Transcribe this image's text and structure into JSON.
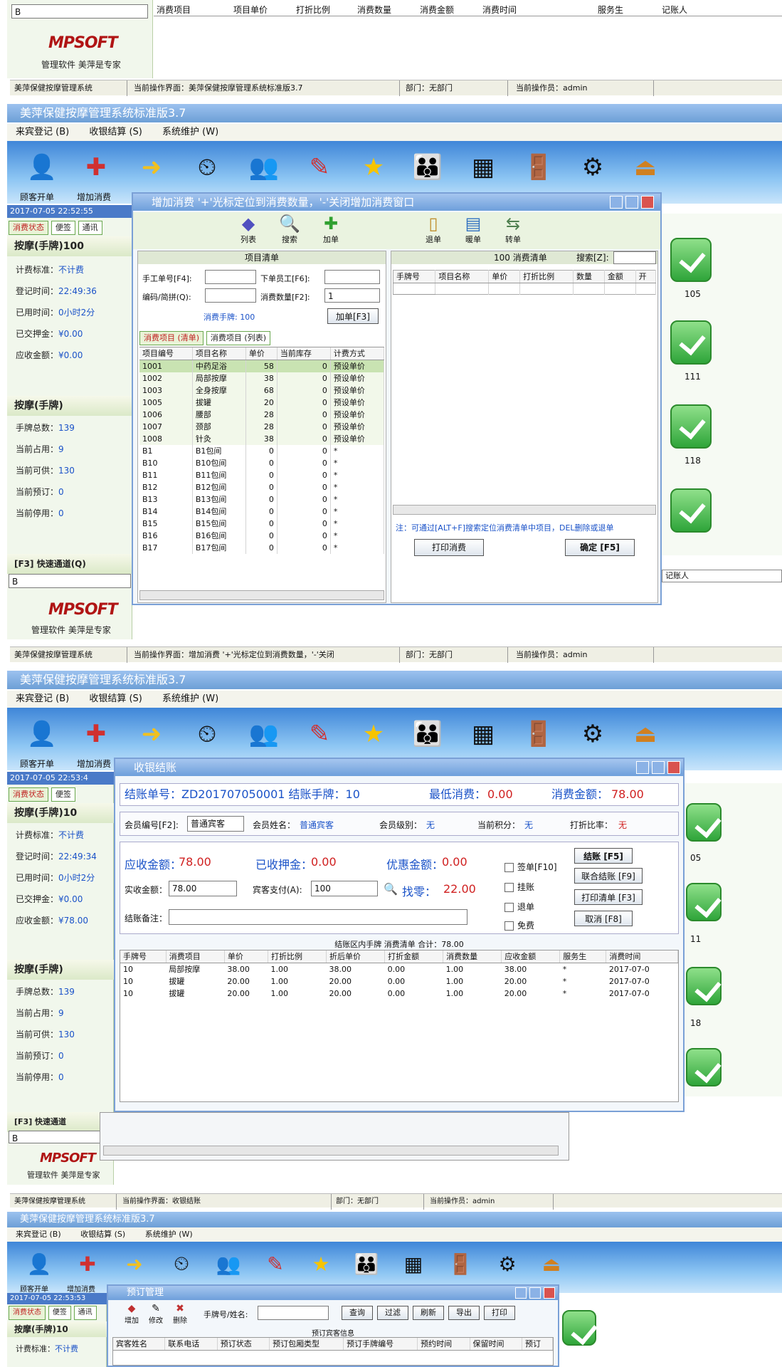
{
  "top_fragment": {
    "field_value": "B",
    "columns": [
      "消费项目",
      "项目单价",
      "打折比例",
      "消费数量",
      "消费金额",
      "消费时间",
      "服务生",
      "记账人"
    ],
    "logo": "MPSOFT",
    "logo_sub": "管理软件 美萍是专家",
    "status": [
      "美萍保健按摩管理系统",
      "当前操作界面：美萍保健按摩管理系统标准版3.7",
      "部门：无部门",
      "当前操作员：admin"
    ]
  },
  "app": {
    "title": "美萍保健按摩管理系统标准版3.7",
    "menu": [
      "来宾登记 (B)",
      "收银结算 (S)",
      "系统维护 (W)"
    ],
    "toolbar_labels": [
      "顾客开单",
      "增加消费"
    ],
    "datetime": "2017-07-05 22:52:55",
    "datetime2": "2017-07-05 22:53:4",
    "datetime3": "2017-07-05 22:53:53",
    "side_tabs": [
      "消费状态",
      "便签",
      "通讯"
    ],
    "section1_title": "按摩(手牌)100",
    "section1_title_b": "按摩(手牌)10",
    "kv1": [
      {
        "k": "计费标准：",
        "v": "不计费"
      },
      {
        "k": "登记时间：",
        "v": "22:49:36"
      },
      {
        "k": "已用时间：",
        "v": "0小时2分"
      },
      {
        "k": "已交押金：",
        "v": "¥0.00"
      },
      {
        "k": "应收金额：",
        "v": "¥0.00"
      }
    ],
    "kv1b_due": "¥78.00",
    "kv1b_time": "22:49:34",
    "section2_title": "按摩(手牌)",
    "kv2": [
      {
        "k": "手牌总数：",
        "v": "139"
      },
      {
        "k": "当前占用：",
        "v": "9"
      },
      {
        "k": "当前可供：",
        "v": "130"
      },
      {
        "k": "当前预订：",
        "v": "0"
      },
      {
        "k": "当前停用：",
        "v": "0"
      }
    ],
    "quick_channel": "[F3] 快速通道(Q)",
    "quick_channel_short": "[F3] 快速通道",
    "quick_value": "B",
    "logo": "MPSOFT",
    "logo_sub": "管理软件 美萍是专家",
    "room_numbers": [
      "105",
      "111",
      "118"
    ],
    "room_numbers_b": [
      "05",
      "11",
      "18"
    ],
    "status2": [
      "美萍保健按摩管理系统",
      "当前操作界面：增加消费 '+'光标定位到消费数量，'-'关闭",
      "部门：无部门",
      "当前操作员：admin"
    ],
    "status3": [
      "美萍保健按摩管理系统",
      "当前操作界面：收银结账",
      "部门：无部门",
      "当前操作员：admin"
    ],
    "background_column_last": "记账人"
  },
  "add_dialog": {
    "title": "增加消费 '+'光标定位到消费数量，'-'关闭增加消费窗口",
    "tools_left": [
      "列表",
      "搜索",
      "加单"
    ],
    "tools_right": [
      "退单",
      "暖单",
      "转单"
    ],
    "left_header": "项目清单",
    "manual_no_label": "手工单号[F4]:",
    "staff_label": "下单员工[F6]:",
    "code_label": "编码/简拼(Q):",
    "qty_label": "消费数量[F2]:",
    "qty_value": "1",
    "card_label": "消费手牌: 100",
    "add_btn": "加单[F3]",
    "tabs": [
      "消费项目 (清单)",
      "消费项目 (列表)"
    ],
    "item_columns": [
      "项目编号",
      "项目名称",
      "单价",
      "当前库存",
      "计费方式"
    ],
    "items": [
      [
        "1001",
        "中药足浴",
        "58",
        "0",
        "预设单价"
      ],
      [
        "1002",
        "局部按摩",
        "38",
        "0",
        "预设单价"
      ],
      [
        "1003",
        "全身按摩",
        "68",
        "0",
        "预设单价"
      ],
      [
        "1005",
        "拔罐",
        "20",
        "0",
        "预设单价"
      ],
      [
        "1006",
        "腰部",
        "28",
        "0",
        "预设单价"
      ],
      [
        "1007",
        "颈部",
        "28",
        "0",
        "预设单价"
      ],
      [
        "1008",
        "针灸",
        "38",
        "0",
        "预设单价"
      ],
      [
        "B1",
        "B1包间",
        "0",
        "0",
        "*"
      ],
      [
        "B10",
        "B10包间",
        "0",
        "0",
        "*"
      ],
      [
        "B11",
        "B11包间",
        "0",
        "0",
        "*"
      ],
      [
        "B12",
        "B12包间",
        "0",
        "0",
        "*"
      ],
      [
        "B13",
        "B13包间",
        "0",
        "0",
        "*"
      ],
      [
        "B14",
        "B14包间",
        "0",
        "0",
        "*"
      ],
      [
        "B15",
        "B15包间",
        "0",
        "0",
        "*"
      ],
      [
        "B16",
        "B16包间",
        "0",
        "0",
        "*"
      ],
      [
        "B17",
        "B17包间",
        "0",
        "0",
        "*"
      ]
    ],
    "right_header": "100 消费清单",
    "search_label": "搜索[Z]:",
    "order_columns": [
      "手牌号",
      "项目名称",
      "单价",
      "打折比例",
      "数量",
      "金额",
      "开"
    ],
    "note": "注：可通过[ALT+F]搜索定位消费清单中项目，DEL删除或退单",
    "print_btn": "打印消费",
    "ok_btn": "确定 [F5]"
  },
  "checkout": {
    "title": "收银结账",
    "bill_label": "结账单号：ZD201707050001  结账手牌：10",
    "min_label": "最低消费：",
    "min_value": "0.00",
    "amount_label": "消费金额：",
    "amount_value": "78.00",
    "member_no_label": "会员编号[F2]:",
    "member_no_value": "普通宾客",
    "member_name_label": "会员姓名：",
    "member_name_value": "普通宾客",
    "member_level_label": "会员级别：",
    "member_level_value": "无",
    "points_label": "当前积分：",
    "points_value": "无",
    "discount_label": "打折比率：",
    "discount_value": "无",
    "due_label": "应收金额：",
    "due_value": "78.00",
    "deposit_label": "已收押金：",
    "deposit_value": "0.00",
    "promo_label": "优惠金额：",
    "promo_value": "0.00",
    "actual_label": "实收金额：",
    "actual_value": "78.00",
    "guest_pay_label": "宾客支付(A):",
    "guest_pay_value": "100",
    "change_label": "找零：",
    "change_value": "22.00",
    "remark_label": "结账备注：",
    "checkboxes": [
      "签单[F10]",
      "挂账",
      "退单",
      "免费"
    ],
    "buttons": [
      "结账 [F5]",
      "联合结账 [F9]",
      "打印清单 [F3]",
      "取消 [F8]"
    ],
    "summary": "结账区内手牌  消费清单  合计：78.00",
    "columns": [
      "手牌号",
      "消费项目",
      "单价",
      "打折比例",
      "折后单价",
      "打折金额",
      "消费数量",
      "应收金额",
      "服务生",
      "消费时间"
    ],
    "rows": [
      [
        "10",
        "局部按摩",
        "38.00",
        "1.00",
        "38.00",
        "0.00",
        "1.00",
        "38.00",
        "*",
        "2017-07-0"
      ],
      [
        "10",
        "拔罐",
        "20.00",
        "1.00",
        "20.00",
        "0.00",
        "1.00",
        "20.00",
        "*",
        "2017-07-0"
      ],
      [
        "10",
        "拔罐",
        "20.00",
        "1.00",
        "20.00",
        "0.00",
        "1.00",
        "20.00",
        "*",
        "2017-07-0"
      ]
    ]
  },
  "reserve": {
    "title": "预订管理",
    "tools": [
      "增加",
      "修改",
      "删除"
    ],
    "search_label": "手牌号/姓名:",
    "buttons": [
      "查询",
      "过滤",
      "刷新",
      "导出",
      "打印"
    ],
    "header": "预订宾客信息",
    "columns": [
      "宾客姓名",
      "联系电话",
      "预订状态",
      "预订包厢类型",
      "预订手牌编号",
      "预约时间",
      "保留时间",
      "预订"
    ]
  },
  "colors": {
    "accent": "#1a52c8",
    "alert": "#d02020",
    "toolbar": "#3f86d8",
    "green": "#2fa53a"
  }
}
